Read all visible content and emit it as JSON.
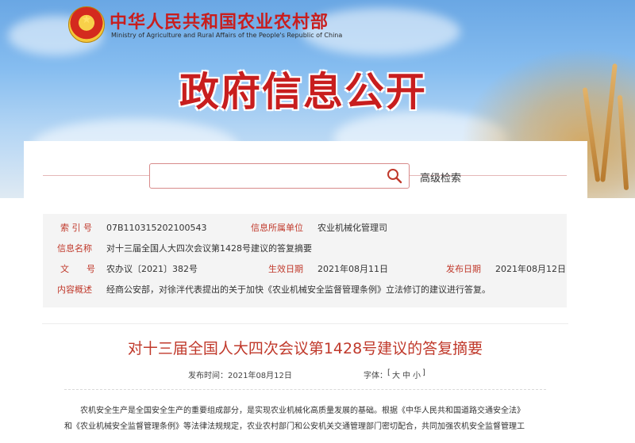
{
  "header": {
    "ministry_name_cn": "中华人民共和国农业农村部",
    "ministry_name_en": "Ministry of Agriculture and Rural Affairs of the People's Republic of China",
    "page_heading": "政府信息公开"
  },
  "search": {
    "placeholder": "",
    "value": "",
    "advanced_label": "高级检索"
  },
  "meta": {
    "index_label": "索 引 号",
    "index_value": "07B110315202100543",
    "unit_label": "信息所属单位",
    "unit_value": "农业机械化管理司",
    "name_label": "信息名称",
    "name_value": "对十三届全国人大四次会议第1428号建议的答复摘要",
    "doc_label": "文　　号",
    "doc_value": "农办议〔2021〕382号",
    "effective_label": "生效日期",
    "effective_value": "2021年08月11日",
    "publish_label": "发布日期",
    "publish_value": "2021年08月12日",
    "summary_label": "内容概述",
    "summary_value": "经商公安部，对徐泮代表提出的关于加快《农业机械安全监督管理条例》立法修订的建议进行答复。"
  },
  "article": {
    "title": "对十三届全国人大四次会议第1428号建议的答复摘要",
    "publish_time_label": "发布时间：",
    "publish_time_value": "2021年08月12日",
    "font_label": "字体：",
    "font_open": "[",
    "font_large": "大",
    "font_medium": "中",
    "font_small": "小",
    "font_close": "]",
    "body_line1": "农机安全生产是全国安全生产的重要组成部分，是实现农业机械化高质量发展的基础。根据《中华人民共和国道路交通安全法》",
    "body_line2": "和《农业机械安全监督管理条例》等法律法规规定，农业农村部门和公安机关交通管理部门密切配合，共同加强农机安全监督管理工"
  },
  "colors": {
    "brand_red": "#c81e1e",
    "label_red": "#c0392b",
    "meta_bg": "#f4f4f4"
  }
}
